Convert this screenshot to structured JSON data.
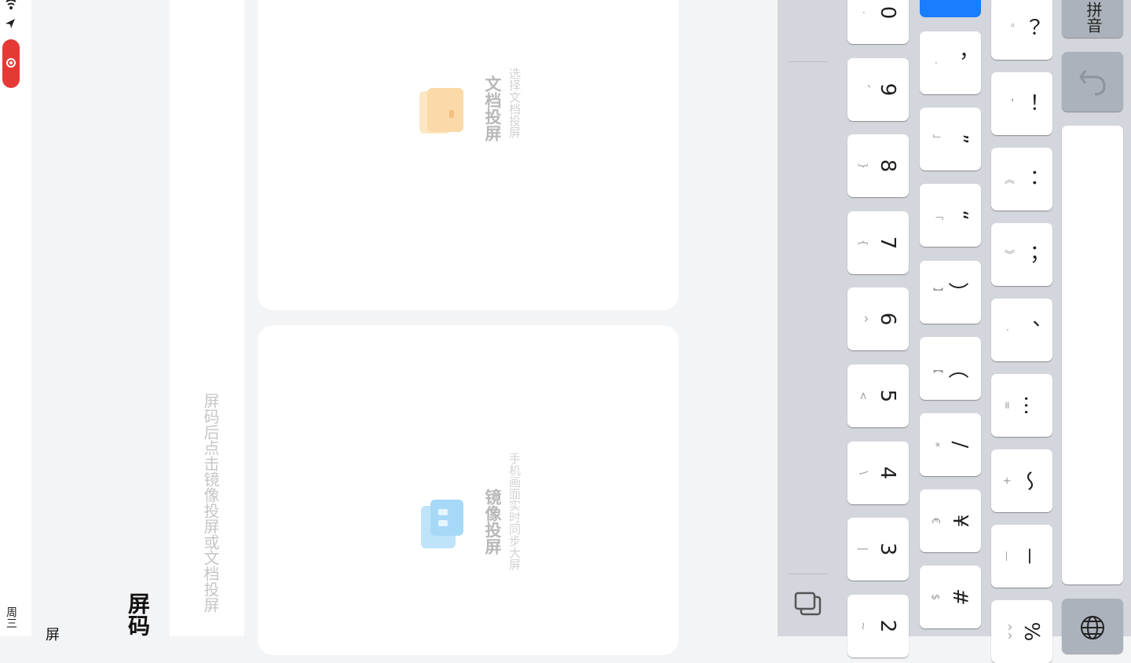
{
  "status_bar": {
    "date_fragment": "周三"
  },
  "header": {
    "title_fragment": "屏码",
    "left_fragment": "屏"
  },
  "instruction": "屏码后点击镜像投屏或文档投屏",
  "cards": {
    "document": {
      "title": "文档投屏",
      "subtitle": "选择文档投屏"
    },
    "mirror": {
      "title": "镜像投屏",
      "subtitle": "手机画面实时同步大屏"
    }
  },
  "keyboard": {
    "row1": [
      {
        "main": "0",
        "sub": "·"
      },
      {
        "main": "9",
        "sub": "、"
      },
      {
        "main": "8",
        "sub": "}"
      },
      {
        "main": "7",
        "sub": "{"
      },
      {
        "main": "6",
        "sub": "^"
      },
      {
        "main": "5",
        "sub": "<"
      },
      {
        "main": "4",
        "sub": "\\"
      },
      {
        "main": "3",
        "sub": "|"
      },
      {
        "main": "2",
        "sub": "~"
      }
    ],
    "row2": [
      {
        "main": "，",
        "sub": "·"
      },
      {
        "main": "”",
        "sub": "」"
      },
      {
        "main": "“",
        "sub": "「"
      },
      {
        "main": "）",
        "sub": "】"
      },
      {
        "main": "（",
        "sub": "【"
      },
      {
        "main": "/",
        "sub": "*"
      },
      {
        "main": "¥",
        "sub": "€"
      },
      {
        "main": "#",
        "sub": "$"
      }
    ],
    "row3": [
      {
        "main": "？",
        "sub": "。"
      },
      {
        "main": "！",
        "sub": "，"
      },
      {
        "main": "：",
        "sub": "《"
      },
      {
        "main": "；",
        "sub": "》"
      },
      {
        "main": "、",
        "sub": "·"
      },
      {
        "main": "…",
        "sub": "="
      },
      {
        "main": "～",
        "sub": "+"
      },
      {
        "main": "－",
        "sub": "—"
      },
      {
        "main": "%",
        "sub": "^^"
      }
    ],
    "mode_label": "拼音",
    "icons": {
      "undo": "undo-icon",
      "globe": "globe-icon",
      "clipboard": "clipboard-icon"
    }
  },
  "colors": {
    "accent": "#1a7cff",
    "record": "#e53935",
    "keyboard_bg": "#d3d6dc",
    "fn_key": "#acb2bb"
  }
}
